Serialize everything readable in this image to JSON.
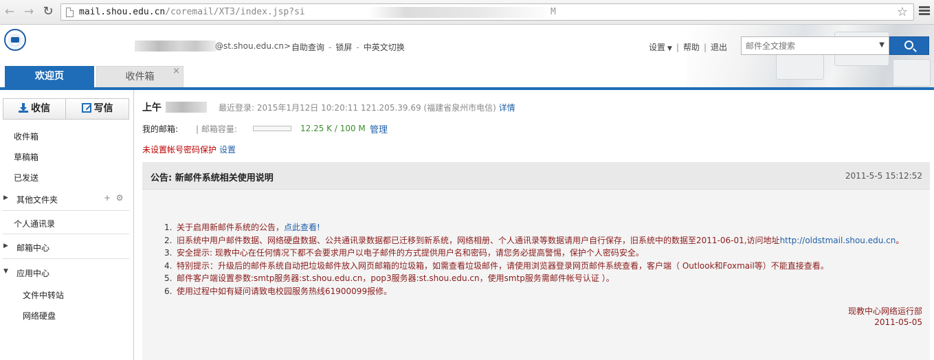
{
  "browser": {
    "url_host": "mail.shou.edu.cn",
    "url_path": "/coremail/XT3/index.jsp?si",
    "url_tail": "M"
  },
  "header": {
    "user_email_suffix": "@st.shou.edu.cn>",
    "links": [
      "自助查询",
      "锁屏",
      "中英文切换"
    ],
    "settings_label": "设置",
    "help_label": "帮助",
    "logout_label": "退出",
    "search_placeholder": "邮件全文搜索"
  },
  "tabs": {
    "welcome": "欢迎页",
    "inbox": "收件箱",
    "close_glyph": "×"
  },
  "sidebar": {
    "receive_label": "收信",
    "write_label": "写信",
    "inbox": "收件箱",
    "drafts": "草稿箱",
    "sent": "已发送",
    "other_folders": "其他文件夹",
    "contacts": "个人通讯录",
    "mail_center": "邮箱中心",
    "app_center": "应用中心",
    "file_transfer": "文件中转站",
    "net_disk": "网络硬盘"
  },
  "main": {
    "greeting": "上午",
    "last_login": "最近登录: 2015年1月12日 10:20:11 121.205.39.69 (福建省泉州市电信)",
    "details_link": "详情",
    "my_mailbox": "我的邮箱:",
    "quota_label": "| 邮箱容量:",
    "quota_fraction": 0.0001,
    "quota_value": "12.25 K / 100 M",
    "manage_link": "管理",
    "password_warning": "未设置帐号密码保护",
    "set_link": "设置"
  },
  "notice": {
    "title": "公告: 新邮件系统相关使用说明",
    "date": "2011-5-5 15:12:52",
    "items": [
      {
        "num": "1.",
        "text": "关于启用新邮件系统的公告，",
        "link": "点此查看!"
      },
      {
        "num": "2.",
        "text": "旧系统中用户邮件数据、网络硬盘数据、公共通讯录数据都已迁移到新系统，网络相册、个人通讯录等数据请用户自行保存，旧系统中的数据至2011-06-01,访问地址",
        "link": "http://oldstmail.shou.edu.cn",
        "suffix": "。"
      },
      {
        "num": "3.",
        "text": "安全提示: 现教中心在任何情况下都不会要求用户以电子邮件的方式提供用户名和密码，请您务必提高警惕，保护个人密码安全。"
      },
      {
        "num": "4.",
        "text": "特别提示：升级后的邮件系统自动把垃圾邮件放入网页邮箱的垃圾箱，如需查看垃圾邮件，请使用浏览器登录网页邮件系统查看，客户端（ Outlook和Foxmail等）不能直接查看。"
      },
      {
        "num": "5.",
        "text": "邮件客户端设置参数:smtp服务器:st.shou.edu.cn，pop3服务器:st.shou.edu.cn，使用smtp服务需邮件帐号认证 ）。"
      },
      {
        "num": "6.",
        "text": "使用过程中如有疑问请致电校园服务热线61900099报修。"
      }
    ],
    "signature": "现教中心网络运行部",
    "sign_date": "2011-05-05"
  }
}
